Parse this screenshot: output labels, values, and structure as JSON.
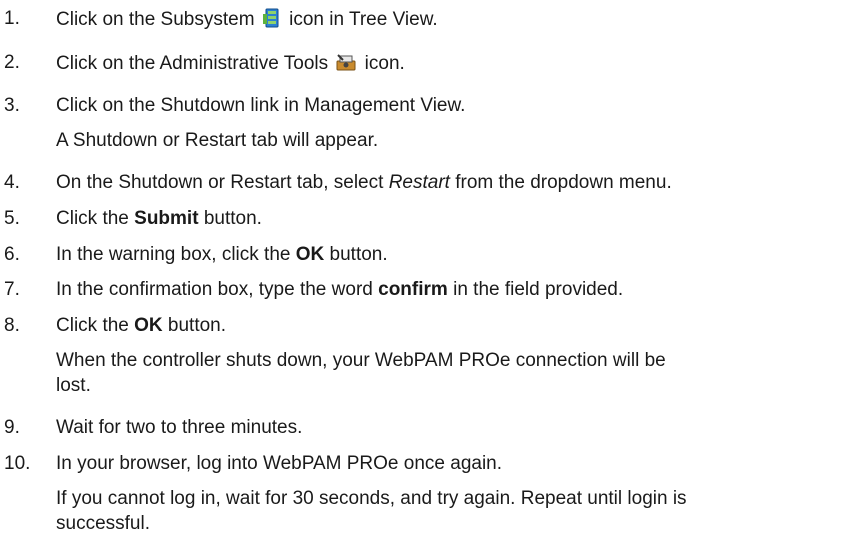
{
  "steps": [
    {
      "number": "1.",
      "text_before": "Click on the Subsystem",
      "icon": "subsystem-icon",
      "text_after": "icon in Tree View."
    },
    {
      "number": "2.",
      "text_before": "Click on the Administrative Tools",
      "icon": "administrative-tools-icon",
      "text_after": "icon."
    },
    {
      "number": "3.",
      "text": "Click on the Shutdown link in Management View.",
      "note": "A Shutdown or Restart tab will appear."
    },
    {
      "number": "4.",
      "text_before": "On the Shutdown or Restart tab, select",
      "emphasis": "Restart",
      "text_after": "from the dropdown menu."
    },
    {
      "number": "5.",
      "text_before": "Click the",
      "bold": "Submit",
      "text_after": "button."
    },
    {
      "number": "6.",
      "text_before": "In the warning box, click the",
      "bold": "OK",
      "text_after": "button."
    },
    {
      "number": "7.",
      "text_before": "In the confirmation box, type the word",
      "bold": "confirm",
      "text_after": "in the field provided."
    },
    {
      "number": "8.",
      "text_before": "Click the",
      "bold": "OK",
      "text_after": "button.",
      "note_line1": "When the controller shuts down, your WebPAM PROe connection will be",
      "note_line2": "lost."
    },
    {
      "number": "9.",
      "text": "Wait for two to three minutes."
    },
    {
      "number": "10.",
      "text": "In your browser, log into WebPAM PROe once again.",
      "note_line1": "If you cannot log in, wait for 30 seconds, and try again. Repeat until login is",
      "note_line2": "successful."
    }
  ]
}
